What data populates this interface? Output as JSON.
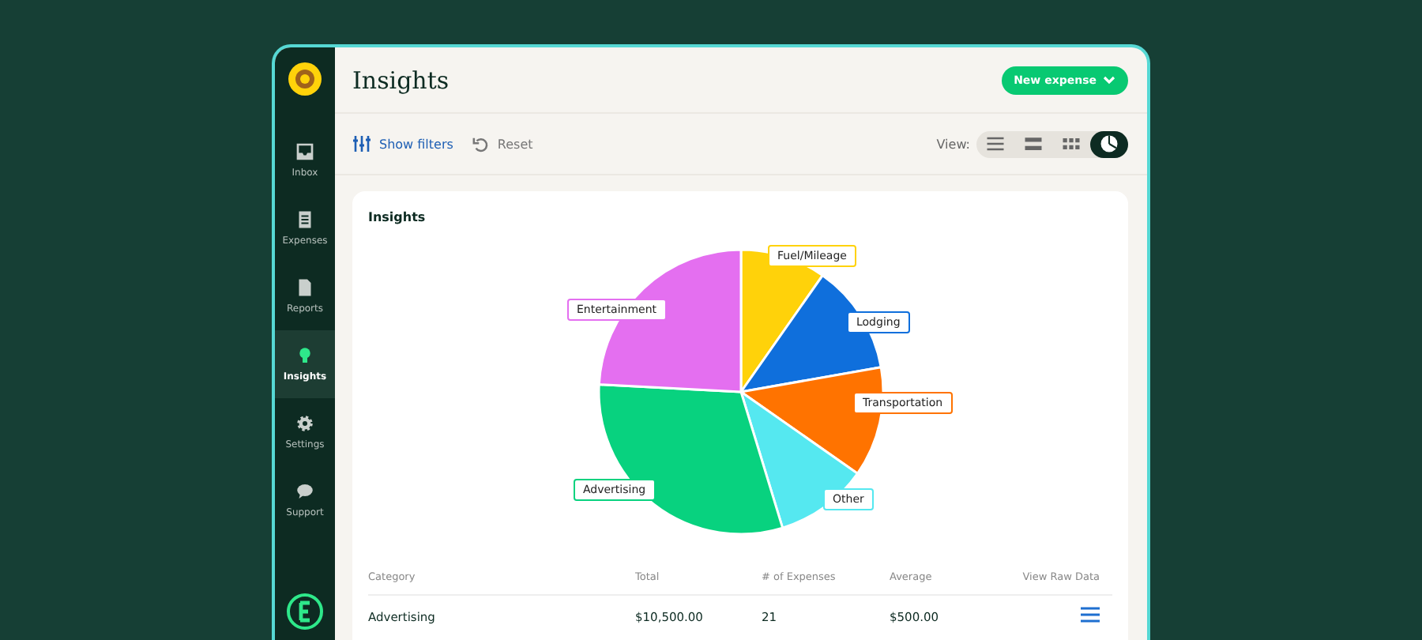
{
  "sidebar": {
    "items": [
      {
        "kind": "inbox",
        "label": "Inbox",
        "selected": false
      },
      {
        "kind": "expenses",
        "label": "Expenses",
        "selected": false
      },
      {
        "kind": "reports",
        "label": "Reports",
        "selected": false
      },
      {
        "kind": "insights",
        "label": "Insights",
        "selected": true
      },
      {
        "kind": "settings",
        "label": "Settings",
        "selected": false
      },
      {
        "kind": "support",
        "label": "Support",
        "selected": false
      }
    ]
  },
  "header": {
    "title": "Insights",
    "new_button": "New expense"
  },
  "toolbar": {
    "show_filters": "Show filters",
    "reset": "Reset",
    "view_label": "View:",
    "views": [
      {
        "kind": "list",
        "selected": false
      },
      {
        "kind": "rows",
        "selected": false
      },
      {
        "kind": "grid",
        "selected": false
      },
      {
        "kind": "chart",
        "selected": true
      }
    ]
  },
  "card": {
    "title": "Insights",
    "pie": {
      "slices": [
        {
          "label": "Fuel/Mileage",
          "color": "#ffd20a"
        },
        {
          "label": "Lodging",
          "color": "#0f6fdc"
        },
        {
          "label": "Transportation",
          "color": "#ff7300"
        },
        {
          "label": "Other",
          "color": "#55e8f0"
        },
        {
          "label": "Advertising",
          "color": "#08d27f"
        },
        {
          "label": "Entertainment",
          "color": "#e46ff0"
        }
      ]
    },
    "table": {
      "columns": [
        "Category",
        "Total",
        "# of Expenses",
        "Average",
        "View Raw Data"
      ],
      "rows": [
        {
          "category": "Advertising",
          "total": "$10,500.00",
          "count": "21",
          "average": "$500.00"
        }
      ]
    }
  }
}
